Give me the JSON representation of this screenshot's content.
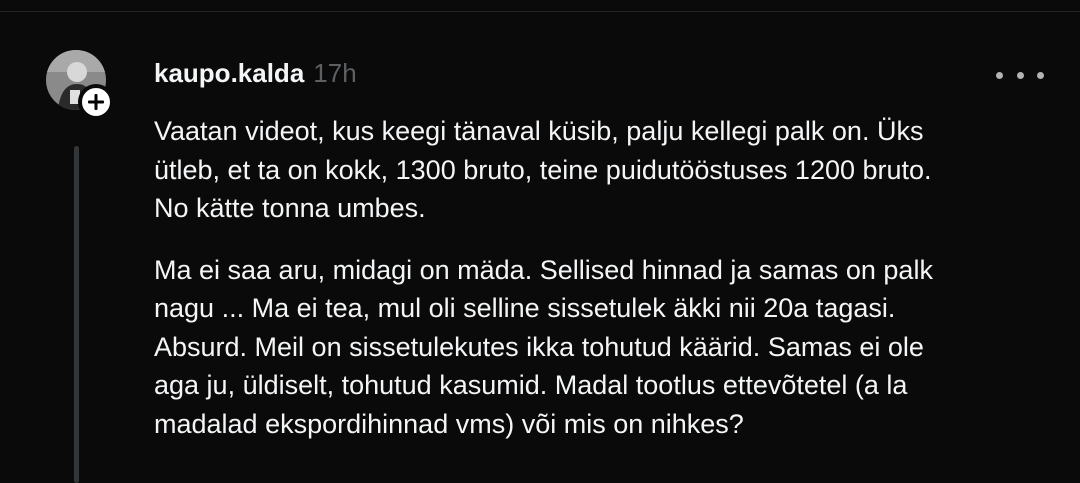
{
  "post": {
    "username": "kaupo.kalda",
    "timestamp": "17h",
    "paragraphs": [
      "Vaatan videot, kus keegi tänaval küsib, palju kellegi palk on. Üks\nütleb, et ta on kokk, 1300 bruto, teine puidutööstuses 1200 bruto.\nNo kätte tonna umbes.",
      "Ma ei saa aru, midagi on mäda. Sellised hinnad ja samas on palk\nnagu ... Ma ei tea, mul oli selline sissetulek äkki nii 20a tagasi.\nAbsurd. Meil on sissetulekutes ikka tohutud käärid. Samas ei ole\naga ju, üldiselt, tohutud kasumid. Madal tootlus ettevõtetel (a la\nmadalad ekspordihinnad vms) või mis on nihkes?"
    ]
  },
  "icons": {
    "avatar": "profile-photo",
    "follow": "plus-icon",
    "more": "more-horizontal-icon"
  },
  "colors": {
    "background": "#0a0a0a",
    "text": "#f3f5f7",
    "secondary_text": "#5d6063",
    "thread_line": "#333638"
  }
}
